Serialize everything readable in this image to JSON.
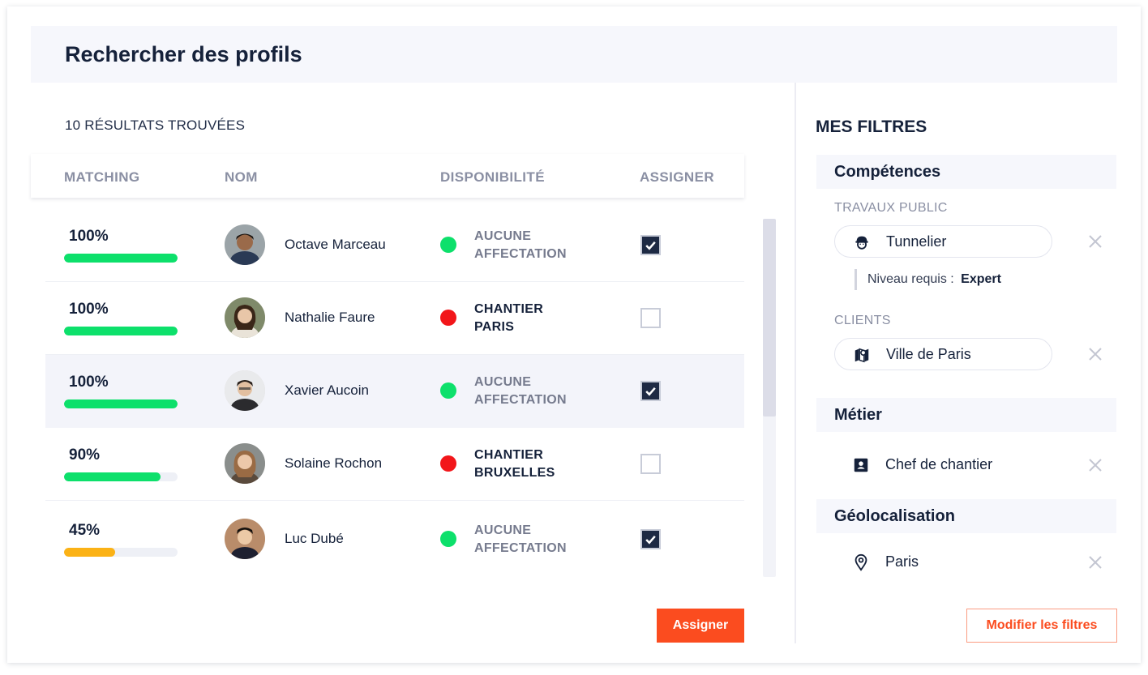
{
  "page": {
    "title": "Rechercher des profils"
  },
  "results": {
    "count_label": "10 RÉSULTATS TROUVÉES",
    "columns": {
      "matching": "MATCHING",
      "nom": "NOM",
      "disponibilite": "DISPONIBILITÉ",
      "assigner": "ASSIGNER"
    },
    "rows": [
      {
        "pct": "100%",
        "match": 1.0,
        "bar_color": "#0de06b",
        "name": "Octave Marceau",
        "status_line1": "AUCUNE",
        "status_line2": "AFFECTATION",
        "status_type": "available",
        "dot_color": "#0de06b",
        "checked": true,
        "highlight": false
      },
      {
        "pct": "100%",
        "match": 1.0,
        "bar_color": "#0de06b",
        "name": "Nathalie Faure",
        "status_line1": "CHANTIER",
        "status_line2": "PARIS",
        "status_type": "busy",
        "dot_color": "#f2161a",
        "checked": false,
        "highlight": false
      },
      {
        "pct": "100%",
        "match": 1.0,
        "bar_color": "#0de06b",
        "name": "Xavier Aucoin",
        "status_line1": "AUCUNE",
        "status_line2": "AFFECTATION",
        "status_type": "available",
        "dot_color": "#0de06b",
        "checked": true,
        "highlight": true
      },
      {
        "pct": "90%",
        "match": 0.85,
        "bar_color": "#0de06b",
        "name": "Solaine Rochon",
        "status_line1": "CHANTIER",
        "status_line2": "BRUXELLES",
        "status_type": "busy",
        "dot_color": "#f2161a",
        "checked": false,
        "highlight": false
      },
      {
        "pct": "45%",
        "match": 0.45,
        "bar_color": "#fbb216",
        "name": "Luc Dubé",
        "status_line1": "AUCUNE",
        "status_line2": "AFFECTATION",
        "status_type": "available",
        "dot_color": "#0de06b",
        "checked": true,
        "highlight": false
      }
    ],
    "assign_button": "Assigner"
  },
  "filters": {
    "title": "MES FILTRES",
    "competences": {
      "label": "Compétences",
      "travaux_label": "TRAVAUX PUBLIC",
      "travaux_value": "Tunnelier",
      "niveau_label": "Niveau requis :",
      "niveau_value": "Expert",
      "clients_label": "CLIENTS",
      "clients_value": "Ville de Paris"
    },
    "metier": {
      "label": "Métier",
      "value": "Chef de chantier"
    },
    "geo": {
      "label": "Géolocalisation",
      "value": "Paris"
    },
    "modify_button": "Modifier les filtres"
  }
}
